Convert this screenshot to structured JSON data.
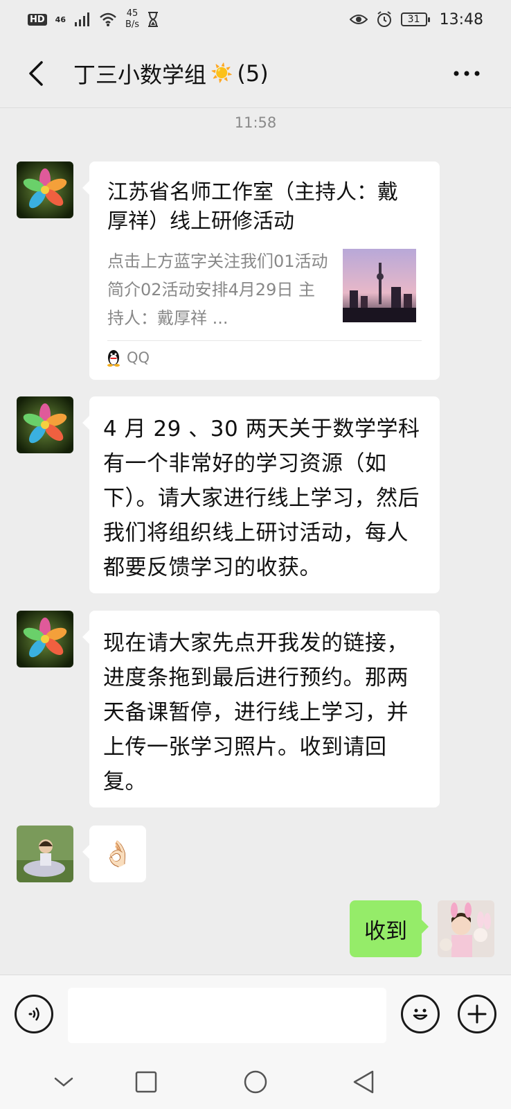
{
  "status_bar": {
    "hd": "HD",
    "network": "46",
    "speed_value": "45",
    "speed_unit": "B/s",
    "battery": "31",
    "time": "13:48"
  },
  "header": {
    "title": "丁三小数学组",
    "title_emoji": "☀️",
    "member_count": "(5)"
  },
  "chat": {
    "timestamp": "11:58",
    "link_card": {
      "title": "江苏省名师工作室（主持人：戴厚祥）线上研修活动",
      "description": "点击上方蓝字关注我们01活动简介02活动安排4月29日 主持人：戴厚祥 ...",
      "source": "QQ"
    },
    "message_1": "4 月 29 、30 两天关于数学学科有一个非常好的学习资源（如下）。请大家进行线上学习，然后我们将组织线上研讨活动，每人都要反馈学习的收获。",
    "message_2": "现在请大家先点开我发的链接，进度条拖到最后进行预约。那两天备课暂停，进行线上学习，并上传一张学习照片。收到请回复。",
    "message_3_emoji": "👌🏻",
    "my_reply": "收到"
  },
  "input": {
    "placeholder": "",
    "value": ""
  },
  "icons": {
    "back": "back-arrow-icon",
    "more": "more-dots-icon",
    "voice": "voice-icon",
    "emoji": "emoji-icon",
    "plus": "plus-icon",
    "qq": "qq-penguin-icon",
    "nav_down": "chevron-down-icon",
    "nav_recent": "square-icon",
    "nav_home": "circle-icon",
    "nav_back": "triangle-back-icon"
  },
  "colors": {
    "background": "#ededed",
    "bubble_mine": "#95ec69",
    "bubble_other": "#ffffff",
    "muted_text": "#888888"
  }
}
